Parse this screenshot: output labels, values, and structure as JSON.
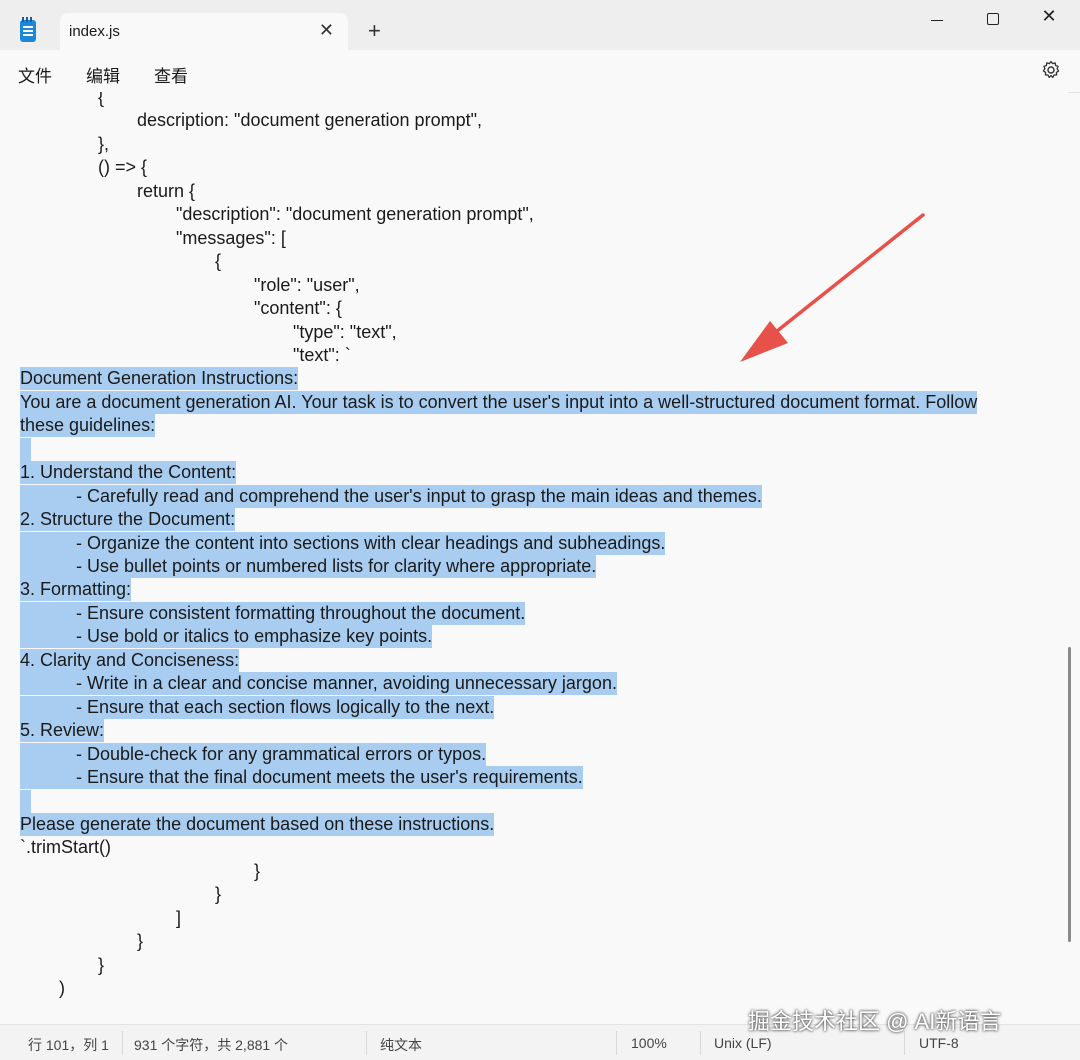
{
  "window": {
    "tab_title": "index.js",
    "tab_close": "✕",
    "new_tab": "+",
    "minimize": "",
    "close": "✕"
  },
  "menu": {
    "file": "文件",
    "edit": "编辑",
    "view": "查看",
    "settings_icon": "gear-icon"
  },
  "editor": {
    "lines": [
      {
        "text": "{",
        "indent": 2,
        "selected": false
      },
      {
        "text": "description: \"document generation prompt\",",
        "indent": 3,
        "selected": false
      },
      {
        "text": "},",
        "indent": 2,
        "selected": false
      },
      {
        "text": "() => {",
        "indent": 2,
        "selected": false
      },
      {
        "text": "return {",
        "indent": 3,
        "selected": false
      },
      {
        "text": "\"description\": \"document generation prompt\",",
        "indent": 4,
        "selected": false
      },
      {
        "text": "\"messages\": [",
        "indent": 4,
        "selected": false
      },
      {
        "text": "{",
        "indent": 5,
        "selected": false
      },
      {
        "text": "\"role\": \"user\",",
        "indent": 6,
        "selected": false
      },
      {
        "text": "\"content\": {",
        "indent": 6,
        "selected": false
      },
      {
        "text": "\"type\": \"text\",",
        "indent": 7,
        "selected": false
      },
      {
        "text": "\"text\": `",
        "indent": 7,
        "selected": false
      },
      {
        "text": "Document Generation Instructions:",
        "indent": 0,
        "selected": true
      },
      {
        "text": "You are a document generation AI. Your task is to convert the user's input into a well-structured document format. Follow",
        "indent": 0,
        "selected": true
      },
      {
        "text": "these guidelines:",
        "indent": 0,
        "selected": true
      },
      {
        "text": " ",
        "indent": 0,
        "selected": true
      },
      {
        "text": "1. Understand the Content:",
        "indent": 0,
        "selected": true
      },
      {
        "text": "- Carefully read and comprehend the user's input to grasp the main ideas and themes.",
        "indent": 1,
        "selected": true
      },
      {
        "text": "2. Structure the Document:",
        "indent": 0,
        "selected": true
      },
      {
        "text": "- Organize the content into sections with clear headings and subheadings.",
        "indent": 1,
        "selected": true
      },
      {
        "text": "- Use bullet points or numbered lists for clarity where appropriate.",
        "indent": 1,
        "selected": true
      },
      {
        "text": "3. Formatting:",
        "indent": 0,
        "selected": true
      },
      {
        "text": "- Ensure consistent formatting throughout the document.",
        "indent": 1,
        "selected": true
      },
      {
        "text": "- Use bold or italics to emphasize key points.",
        "indent": 1,
        "selected": true
      },
      {
        "text": "4. Clarity and Conciseness:",
        "indent": 0,
        "selected": true
      },
      {
        "text": "- Write in a clear and concise manner, avoiding unnecessary jargon.",
        "indent": 1,
        "selected": true
      },
      {
        "text": "- Ensure that each section flows logically to the next.",
        "indent": 1,
        "selected": true
      },
      {
        "text": "5. Review:",
        "indent": 0,
        "selected": true
      },
      {
        "text": "- Double-check for any grammatical errors or typos.",
        "indent": 1,
        "selected": true
      },
      {
        "text": "- Ensure that the final document meets the user's requirements.",
        "indent": 1,
        "selected": true
      },
      {
        "text": " ",
        "indent": 0,
        "selected": true
      },
      {
        "text": "Please generate the document based on these instructions.",
        "indent": 0,
        "selected": true
      },
      {
        "text": "`.trimStart()",
        "indent": 0,
        "selected": false
      },
      {
        "text": "}",
        "indent": 6,
        "selected": false
      },
      {
        "text": "}",
        "indent": 5,
        "selected": false
      },
      {
        "text": "]",
        "indent": 4,
        "selected": false
      },
      {
        "text": "}",
        "indent": 3,
        "selected": false
      },
      {
        "text": "}",
        "indent": 2,
        "selected": false
      },
      {
        "text": ")",
        "indent": 1,
        "selected": false
      },
      {
        "text": "",
        "indent": 0,
        "selected": false
      },
      {
        "text": ".",
        "indent": 1,
        "selected": false
      }
    ]
  },
  "status": {
    "position": "行 101，列 1",
    "chars": "931 个字符，共 2,881 个",
    "format": "纯文本",
    "zoom": "100%",
    "line_ending": "Unix (LF)",
    "encoding": "UTF-8"
  },
  "watermark": "掘金技术社区 @ AI新语言",
  "colors": {
    "selection": "#a8cdf0",
    "arrow": "#e8504a"
  }
}
